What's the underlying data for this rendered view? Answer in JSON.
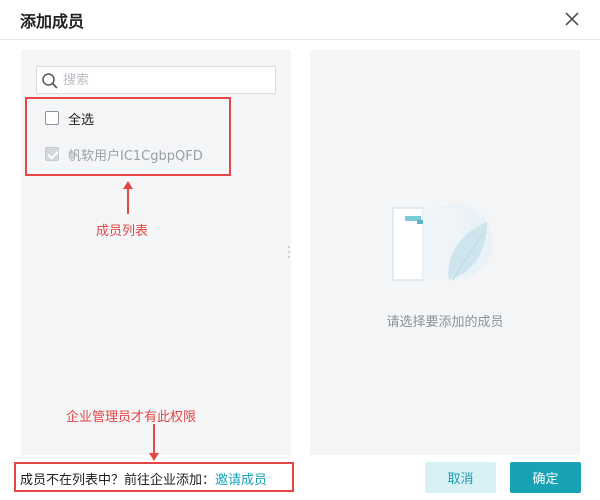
{
  "dialog": {
    "title": "添加成员",
    "close_icon": "close-icon"
  },
  "search": {
    "placeholder": "搜索",
    "icon": "search-icon"
  },
  "member_list": {
    "select_all_label": "全选",
    "items": [
      {
        "label": "帆软用户IC1CgbpQFD",
        "checked": true,
        "disabled": true
      }
    ]
  },
  "annotations": {
    "member_list": "成员列表",
    "admin_only": "企业管理员才有此权限"
  },
  "empty_state": {
    "text": "请选择要添加的成员"
  },
  "footer": {
    "prompt": "成员不在列表中？前往企业添加：",
    "invite_link": "邀请成员",
    "cancel_label": "取消",
    "ok_label": "确定"
  },
  "colors": {
    "accent": "#17a3b4",
    "annotation": "#e64545"
  }
}
